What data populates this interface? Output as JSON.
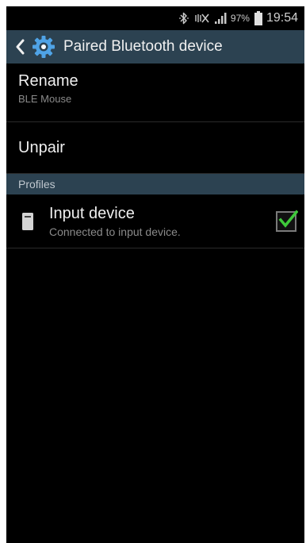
{
  "status_bar": {
    "battery_percent": "97%",
    "time": "19:54",
    "icons": [
      "bluetooth-icon",
      "mute-icon",
      "signal-icon",
      "battery-icon"
    ]
  },
  "action_bar": {
    "title": "Paired Bluetooth device",
    "icons": [
      "back-icon",
      "settings-gear-icon"
    ]
  },
  "rename": {
    "label": "Rename",
    "device_name": "BLE Mouse"
  },
  "unpair": {
    "label": "Unpair"
  },
  "profiles": {
    "header": "Profiles",
    "items": [
      {
        "label": "Input device",
        "status": "Connected to input device.",
        "checked": true
      }
    ]
  },
  "colors": {
    "action_bar_bg": "#2c4251",
    "background": "#000000",
    "accent_check": "#3ec93a"
  }
}
